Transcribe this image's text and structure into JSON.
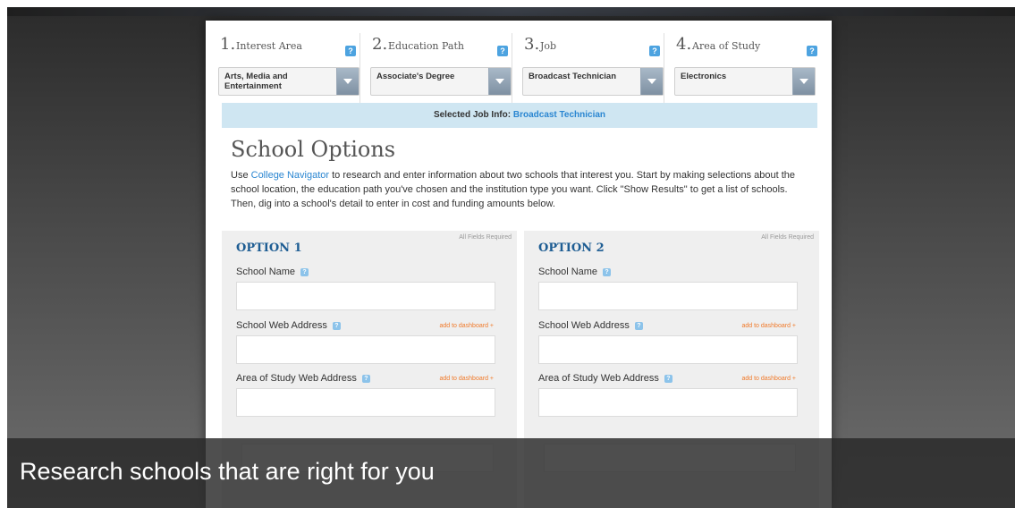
{
  "steps": [
    {
      "number": "1.",
      "name": "Interest Area",
      "selected": "Arts, Media and Entertainment"
    },
    {
      "number": "2.",
      "name": "Education Path",
      "selected": "Associate's Degree"
    },
    {
      "number": "3.",
      "name": "Job",
      "selected": "Broadcast Technician"
    },
    {
      "number": "4.",
      "name": "Area of Study",
      "selected": "Electronics"
    }
  ],
  "help_symbol": "?",
  "job_info": {
    "label": "Selected Job Info:",
    "job": "Broadcast Technician"
  },
  "section_title": "School Options",
  "intro": {
    "prefix": "Use ",
    "link": "College Navigator",
    "text": " to research and enter information about two schools that interest you. Start by making selections about the school location, the education path you've chosen and the institution type you want. Click \"Show Results\" to get a list of schools. Then, dig into a school's detail to enter in cost and funding amounts below."
  },
  "options": [
    {
      "title": "OPTION 1",
      "required_note": "All Fields Required",
      "fields": [
        {
          "label": "School Name",
          "value": "",
          "dashboard_link": ""
        },
        {
          "label": "School Web Address",
          "value": "",
          "dashboard_link": "add to dashboard +"
        },
        {
          "label": "Area of Study Web Address",
          "value": "",
          "dashboard_link": "add to dashboard +"
        }
      ]
    },
    {
      "title": "OPTION 2",
      "required_note": "All Fields Required",
      "fields": [
        {
          "label": "School Name",
          "value": "",
          "dashboard_link": ""
        },
        {
          "label": "School Web Address",
          "value": "",
          "dashboard_link": "add to dashboard +"
        },
        {
          "label": "Area of Study Web Address",
          "value": "",
          "dashboard_link": "add to dashboard +"
        }
      ]
    }
  ],
  "caption": "Research schools that are right for you",
  "colors": {
    "link_blue": "#2a86d1",
    "option_title": "#1e5d93",
    "dashboard_orange": "#f07a2a",
    "job_bar": "#cfe6f2"
  }
}
